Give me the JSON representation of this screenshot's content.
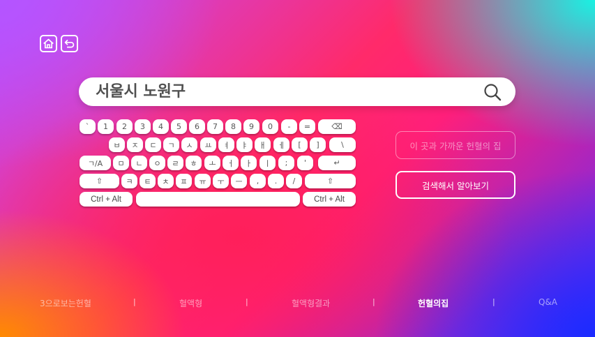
{
  "header": {
    "home_icon": "home-icon",
    "back_icon": "back-arrow-icon"
  },
  "search": {
    "value": "서울시 노원구",
    "icon": "search-icon"
  },
  "keyboard": {
    "row1": [
      "`",
      "1",
      "2",
      "3",
      "4",
      "5",
      "6",
      "7",
      "8",
      "9",
      "0",
      "-",
      "=",
      "⌫"
    ],
    "row2": [
      "ㅂ",
      "ㅈ",
      "ㄷ",
      "ㄱ",
      "ㅅ",
      "ㅛ",
      "ㅕ",
      "ㅑ",
      "ㅐ",
      "ㅔ",
      "[",
      "]",
      "\\"
    ],
    "row3": [
      "ㄱ/A",
      "ㅁ",
      "ㄴ",
      "ㅇ",
      "ㄹ",
      "ㅎ",
      "ㅗ",
      "ㅓ",
      "ㅏ",
      "ㅣ",
      ";",
      "'",
      "↵"
    ],
    "row4": [
      "⇧",
      "ㅋ",
      "ㅌ",
      "ㅊ",
      "ㅍ",
      "ㅠ",
      "ㅜ",
      "ㅡ",
      ",",
      ".",
      "/",
      "⇧"
    ],
    "row5": [
      "Ctrl + Alt",
      "",
      "Ctrl + Alt"
    ]
  },
  "actions": {
    "nearby_label": "이 곳과 가까운 헌혈의 집",
    "search_label": "검색해서 알아보기"
  },
  "nav": {
    "items": [
      "3으로보는헌혈",
      "혈액형",
      "혈액형결과",
      "헌혈의집",
      "Q&A"
    ],
    "separator": "|",
    "current": "헌혈의집"
  }
}
